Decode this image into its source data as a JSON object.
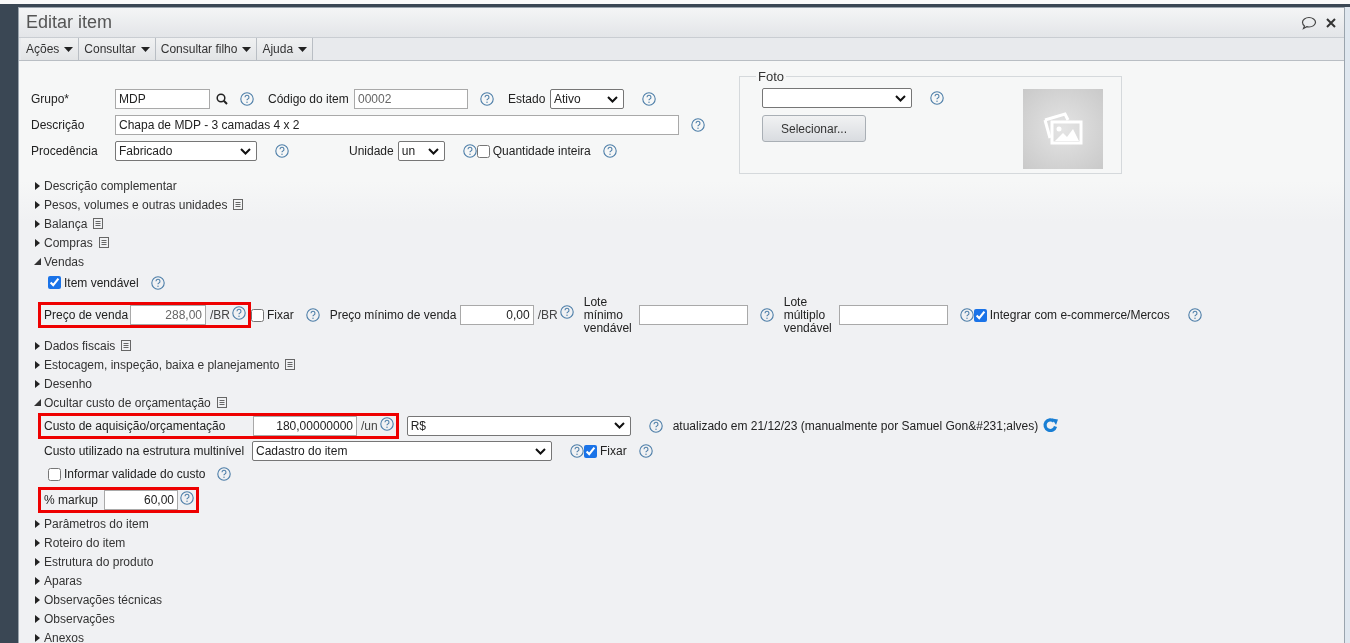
{
  "window": {
    "title": "Editar item"
  },
  "menu": [
    {
      "label": "Ações"
    },
    {
      "label": "Consultar"
    },
    {
      "label": "Consultar filho"
    },
    {
      "label": "Ajuda"
    }
  ],
  "form": {
    "grupo": {
      "label": "Grupo*",
      "value": "MDP"
    },
    "codigo": {
      "label": "Código do item",
      "value": "00002"
    },
    "estado": {
      "label": "Estado",
      "value": "Ativo"
    },
    "descricao": {
      "label": "Descrição",
      "value": "Chapa de MDP - 3 camadas 4 x 2"
    },
    "procedencia": {
      "label": "Procedência",
      "value": "Fabricado"
    },
    "unidade": {
      "label": "Unidade",
      "value": "un"
    },
    "quantidade_inteira": {
      "label": "Quantidade inteira",
      "checked": false
    }
  },
  "foto": {
    "legend": "Foto",
    "button": "Selecionar..."
  },
  "sections": [
    {
      "label": "Descrição complementar",
      "expanded": false,
      "note": false
    },
    {
      "label": "Pesos, volumes e outras unidades",
      "expanded": false,
      "note": true
    },
    {
      "label": "Balança",
      "expanded": false,
      "note": true
    },
    {
      "label": "Compras",
      "expanded": false,
      "note": true
    },
    {
      "label": "Vendas",
      "expanded": true,
      "note": false,
      "vendas": {
        "item_vendavel": {
          "label": "Item vendável",
          "checked": true
        },
        "preco_venda": {
          "label": "Preço de venda",
          "value": "288,00",
          "unit": "/BR"
        },
        "fixar": {
          "label": "Fixar",
          "checked": false
        },
        "preco_minimo": {
          "label": "Preço mínimo de venda",
          "value": "0,00",
          "unit": "/BR"
        },
        "lote_minimo": {
          "label": "Lote mínimo vendável"
        },
        "lote_multiplo": {
          "label": "Lote múltiplo vendável"
        },
        "integrar": {
          "label": "Integrar com e-commerce/Mercos",
          "checked": true
        }
      }
    },
    {
      "label": "Dados fiscais",
      "expanded": false,
      "note": true
    },
    {
      "label": "Estocagem, inspeção, baixa e planejamento",
      "expanded": false,
      "note": true
    },
    {
      "label": "Desenho",
      "expanded": false,
      "note": false
    },
    {
      "label": "Ocultar custo de orçamentação",
      "expanded": true,
      "note": true,
      "custo": {
        "aquisicao": {
          "label": "Custo de aquisição/orçamentação",
          "value": "180,00000000",
          "unit": "/un"
        },
        "moeda": {
          "value": "R$"
        },
        "atualizado": "atualizado em 21/12/23 (manualmente por Samuel Gon&#231;alves)",
        "utilizado": {
          "label": "Custo utilizado na estrutura multinível",
          "value": "Cadastro do item"
        },
        "fixar": {
          "label": "Fixar",
          "checked": true
        },
        "validade": {
          "label": "Informar validade do custo",
          "checked": false
        },
        "markup": {
          "label": "% markup",
          "value": "60,00"
        }
      }
    },
    {
      "label": "Parâmetros do item",
      "expanded": false,
      "note": false
    },
    {
      "label": "Roteiro do item",
      "expanded": false,
      "note": false
    },
    {
      "label": "Estrutura do produto",
      "expanded": false,
      "note": false
    },
    {
      "label": "Aparas",
      "expanded": false,
      "note": false
    },
    {
      "label": "Observações técnicas",
      "expanded": false,
      "note": false
    },
    {
      "label": "Observações",
      "expanded": false,
      "note": false
    },
    {
      "label": "Anexos",
      "expanded": false,
      "note": false
    }
  ]
}
